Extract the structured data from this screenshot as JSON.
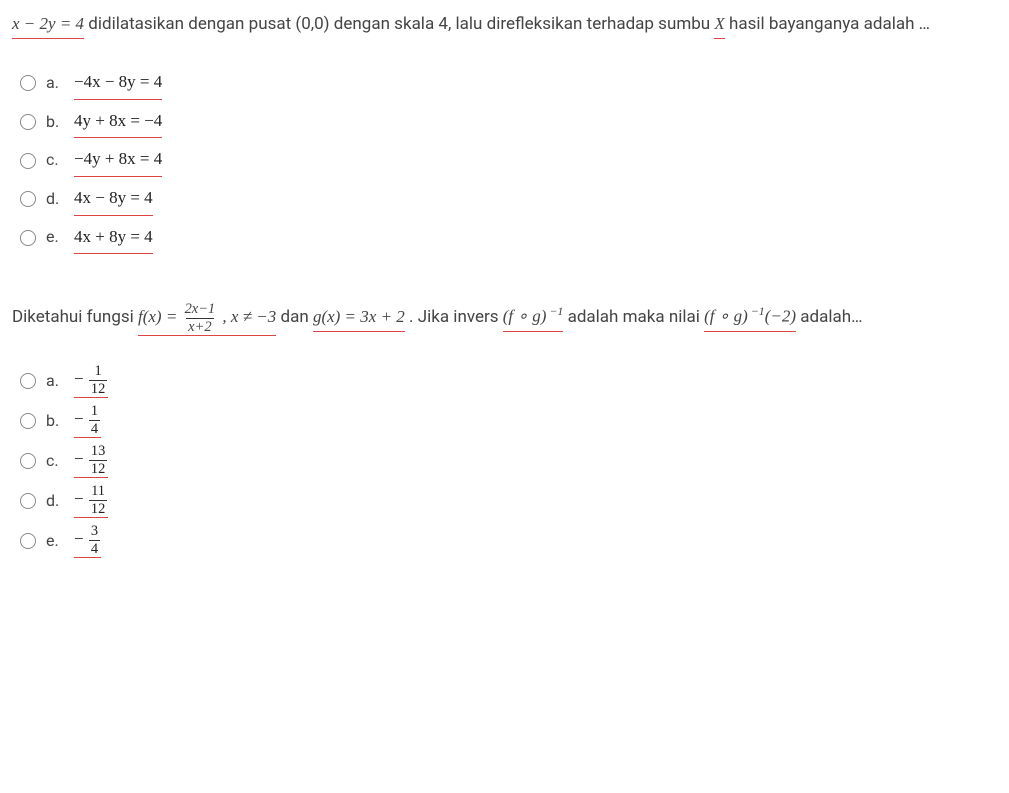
{
  "q1": {
    "stem_math": "x − 2y = 4",
    "stem_text_1": " didilatasikan dengan pusat (0,0) dengan skala 4, lalu direfleksikan terhadap sumbu ",
    "stem_var": "X",
    "stem_text_2": " hasil bayanganya adalah …",
    "options": [
      {
        "letter": "a.",
        "text": "−4x − 8y = 4"
      },
      {
        "letter": "b.",
        "text": "4y + 8x = −4"
      },
      {
        "letter": "c.",
        "text": "−4y + 8x = 4"
      },
      {
        "letter": "d.",
        "text": "4x − 8y = 4"
      },
      {
        "letter": "e.",
        "text": "4x + 8y = 4"
      }
    ]
  },
  "q2": {
    "stem_pre": "Diketahui fungsi ",
    "fx_left": "f(x) = ",
    "fx_num": "2x−1",
    "fx_den": "x+2",
    "cond": " , x ≠ −3",
    "mid_text": " dan ",
    "gx": "g(x) = 3x + 2",
    "mid_text2": ". Jika invers ",
    "fog_inv": "(f ∘ g)",
    "exp1": " −1",
    "stem_post1": " adalah maka nilai ",
    "fog_inv2": "(f ∘ g)",
    "exp2": " −1",
    "arg": "(−2)",
    "stem_post2": " adalah…",
    "options": [
      {
        "letter": "a.",
        "sign": "−",
        "num": "1",
        "den": "12"
      },
      {
        "letter": "b.",
        "sign": "−",
        "num": "1",
        "den": "4"
      },
      {
        "letter": "c.",
        "sign": "−",
        "num": "13",
        "den": "12"
      },
      {
        "letter": "d.",
        "sign": "−",
        "num": "11",
        "den": "12"
      },
      {
        "letter": "e.",
        "sign": "−",
        "num": "3",
        "den": "4"
      }
    ]
  }
}
